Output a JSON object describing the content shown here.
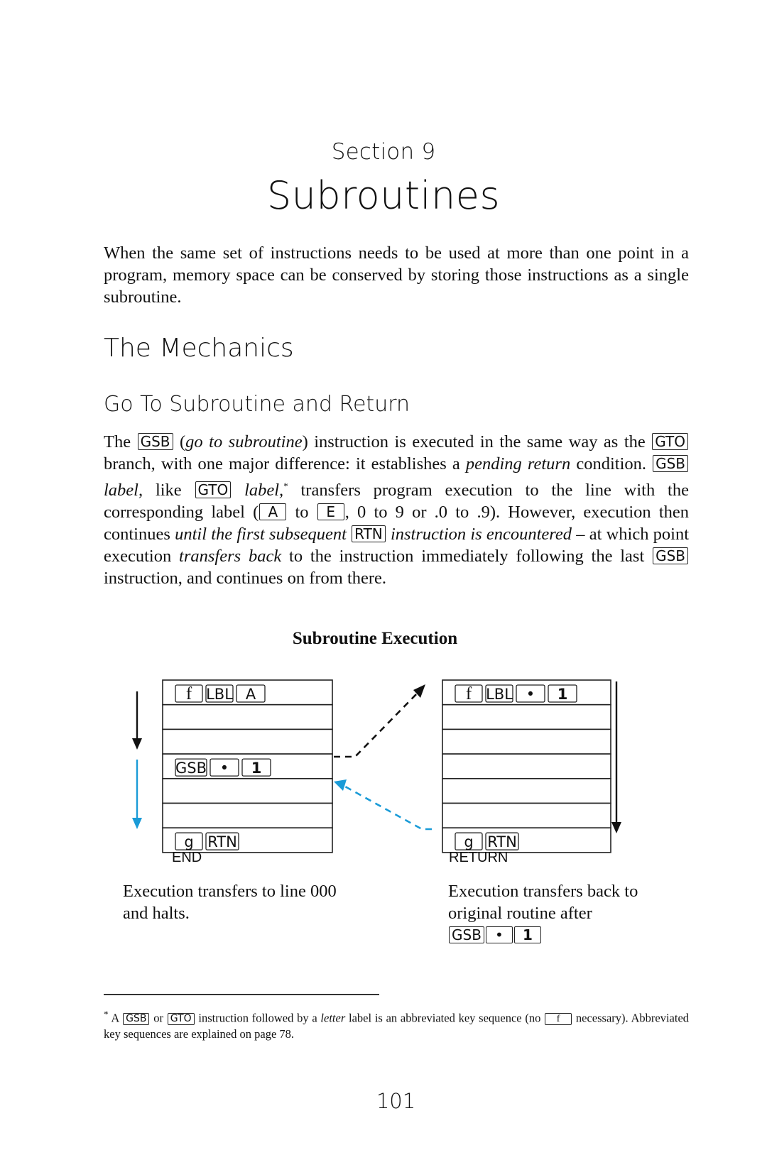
{
  "section_label": "Section 9",
  "chapter_title": "Subroutines",
  "intro": "When the same set of instructions needs to be used at more than one point in a program, memory space can be conserved by storing those instructions as a single subroutine.",
  "headings": {
    "mechanics": "The Mechanics",
    "gosub_return": "Go To Subroutine and Return"
  },
  "body": {
    "t1": "The",
    "k_gsb": "GSB",
    "t2": "(",
    "i_goto_sub": "go to subroutine",
    "t3": ") instruction is executed in the same way as the",
    "k_gto": "GTO",
    "t4": "branch, with one major difference: it establishes a",
    "i_pending": "pending return",
    "t5": "condition.",
    "i_label1": "label,",
    "t6": "like",
    "i_label2": "label,",
    "footnote_mark": "*",
    "t7": "transfers program execution to the line with the corresponding label (",
    "k_a": "A",
    "t8": "to",
    "k_e": "E",
    "t9": ", 0 to 9 or .0 to .9). However, execution then continues",
    "i_until": "until the first subsequent",
    "k_rtn": "RTN",
    "i_instruction": "instruction is encountered",
    "t10": "– at which point execution",
    "i_transfers": "transfers back",
    "t11": "to the instruction immediately following the last",
    "t12": "instruction, and continues on from there."
  },
  "diagram": {
    "title": "Subroutine Execution",
    "left_routine": {
      "rows": [
        [
          "f",
          "LBL",
          "A"
        ],
        [],
        [],
        [
          "GSB",
          "•",
          "1"
        ],
        [],
        [],
        [
          "g",
          "RTN"
        ]
      ],
      "end_label": "END",
      "caption_lines": [
        "Execution transfers to line 000",
        "and halts."
      ]
    },
    "right_routine": {
      "rows": [
        [
          "f",
          "LBL",
          "•",
          "1"
        ],
        [],
        [],
        [],
        [],
        [],
        [
          "g",
          "RTN"
        ]
      ],
      "end_label": "RETURN",
      "caption_lines": [
        "Execution transfers back to",
        "original routine after"
      ],
      "caption_keys": [
        "GSB",
        "•",
        "1"
      ]
    },
    "colors": {
      "call_path": "#111111",
      "return_path": "#1a9bd7"
    }
  },
  "footnote": {
    "mark": "*",
    "t1": "A",
    "k_gsb": "GSB",
    "t2": "or",
    "k_gto": "GTO",
    "t3": "instruction followed by a",
    "i_letter": "letter",
    "t4": "label is an abbreviated key sequence (no",
    "k_f": "f",
    "t5": "necessary). Abbreviated key sequences are explained on page 78."
  },
  "page_number": "101"
}
